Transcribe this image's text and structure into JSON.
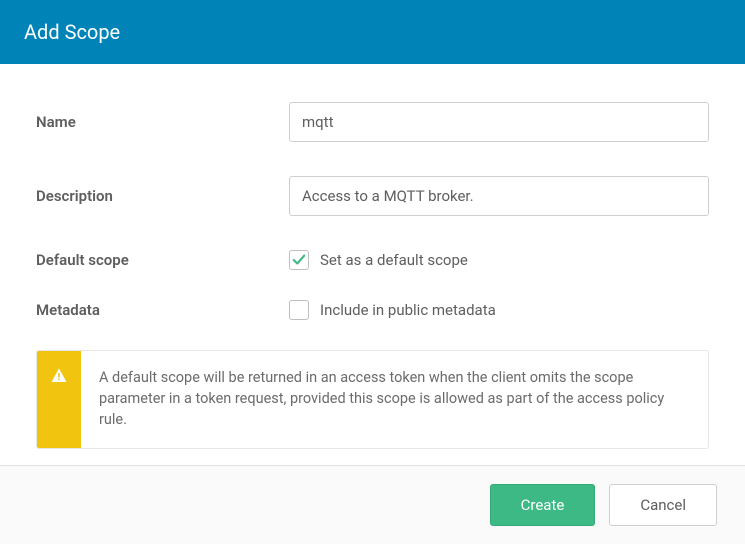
{
  "header": {
    "title": "Add Scope"
  },
  "form": {
    "name": {
      "label": "Name",
      "value": "mqtt"
    },
    "description": {
      "label": "Description",
      "value": "Access to a MQTT broker."
    },
    "default_scope": {
      "label": "Default scope",
      "checkbox_label": "Set as a default scope",
      "checked": true
    },
    "metadata": {
      "label": "Metadata",
      "checkbox_label": "Include in public metadata",
      "checked": false
    }
  },
  "info": {
    "text": "A default scope will be returned in an access token when the client omits the scope parameter in a token request, provided this scope is allowed as part of the access policy rule."
  },
  "footer": {
    "create_label": "Create",
    "cancel_label": "Cancel"
  }
}
